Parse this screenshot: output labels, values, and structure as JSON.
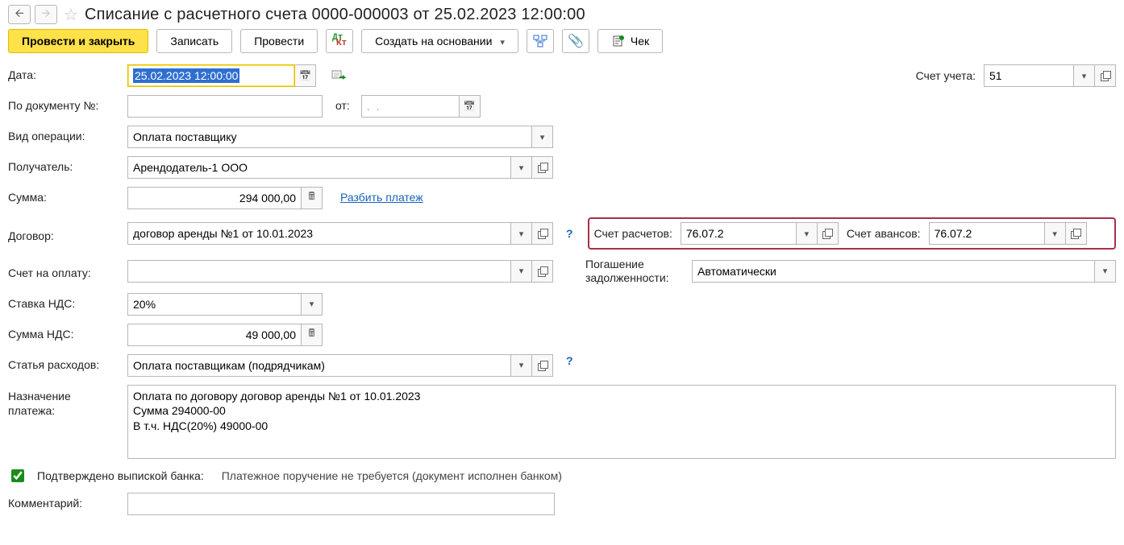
{
  "header": {
    "title": "Списание с расчетного счета 0000-000003 от 25.02.2023 12:00:00"
  },
  "toolbar": {
    "post_close": "Провести и закрыть",
    "write": "Записать",
    "post": "Провести",
    "create_based": "Создать на основании",
    "cheque": "Чек"
  },
  "labels": {
    "date": "Дата:",
    "account": "Счет учета:",
    "doc_no": "По документу №:",
    "from": "от:",
    "op_type": "Вид операции:",
    "recipient": "Получатель:",
    "amount": "Сумма:",
    "split": "Разбить платеж",
    "contract": "Договор:",
    "calc_account": "Счет расчетов:",
    "advance_account": "Счет авансов:",
    "invoice": "Счет на оплату:",
    "debt_repay": "Погашение задолженности:",
    "vat_rate": "Ставка НДС:",
    "vat_sum": "Сумма НДС:",
    "expense_item": "Статья расходов:",
    "purpose": "Назначение платежа:",
    "confirmed": "Подтверждено выпиской банка:",
    "payorder_note": "Платежное поручение не требуется (документ исполнен банком)",
    "comment": "Комментарий:"
  },
  "values": {
    "date": "25.02.2023 12:00:00",
    "account": "51",
    "doc_no": "",
    "from_date": ".  .",
    "op_type": "Оплата поставщику",
    "recipient": "Арендодатель-1 ООО",
    "amount": "294 000,00",
    "contract": "договор аренды №1 от 10.01.2023",
    "calc_account": "76.07.2",
    "advance_account": "76.07.2",
    "invoice": "",
    "debt_repay": "Автоматически",
    "vat_rate": "20%",
    "vat_sum": "49 000,00",
    "expense_item": "Оплата поставщикам (подрядчикам)",
    "purpose": "Оплата по договору договор аренды №1 от 10.01.2023\nСумма 294000-00\nВ т.ч. НДС(20%) 49000-00",
    "confirmed": true,
    "comment": ""
  }
}
